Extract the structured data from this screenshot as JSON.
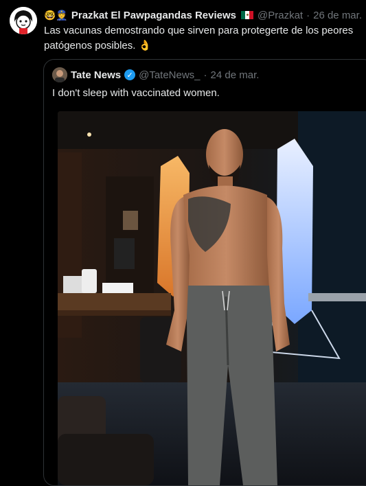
{
  "tweet": {
    "author_emojis": "🤓👮",
    "author_name": "Prazkat El Pawpagandas Reviews",
    "author_handle": "@Prazkat",
    "separator": "·",
    "date": "26 de mar.",
    "text": "Las vacunas demostrando que sirven para protegerte de los peores patógenos posibles.",
    "text_emoji": "👌",
    "flag_icon": "mexico-flag-icon"
  },
  "quoted": {
    "author_name": "Tate News",
    "author_handle": "@TateNews_",
    "separator": "·",
    "date": "24 de mar.",
    "verified_mark": "✓",
    "verified_color": "#1d9bf0",
    "text": "I don't sleep with vaccinated women.",
    "media_icon": "photo-image-icon"
  },
  "colors": {
    "background": "#000000",
    "text": "#e7e9ea",
    "muted": "#71767b",
    "border": "#2f3336"
  }
}
